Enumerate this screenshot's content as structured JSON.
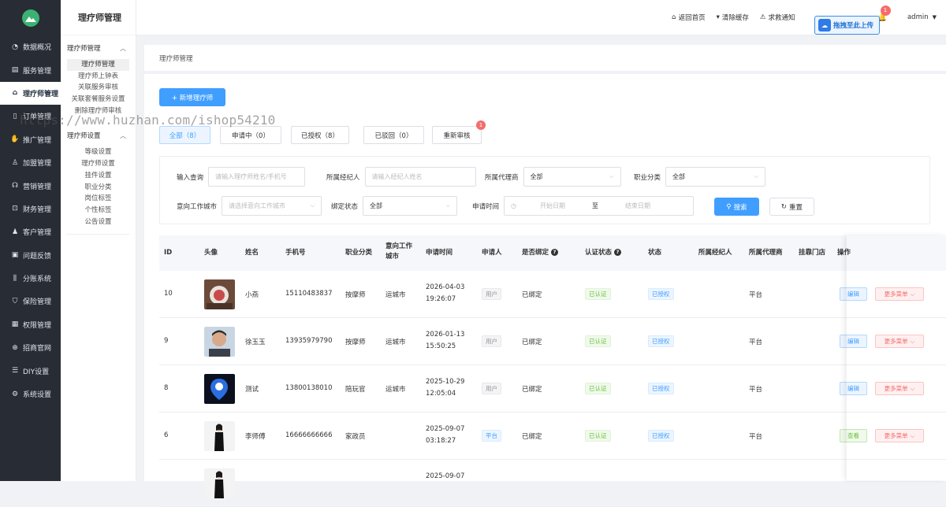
{
  "sidebar": {
    "logo_icon": "mountain-logo",
    "items": [
      {
        "label": "数据概况",
        "icon": "dashboard-icon"
      },
      {
        "label": "服务管理",
        "icon": "service-icon"
      },
      {
        "label": "理疗师管理",
        "icon": "therapist-icon"
      },
      {
        "label": "订单管理",
        "icon": "order-icon"
      },
      {
        "label": "推广管理",
        "icon": "promotion-icon"
      },
      {
        "label": "加盟管理",
        "icon": "franchise-icon"
      },
      {
        "label": "营销管理",
        "icon": "marketing-icon"
      },
      {
        "label": "财务管理",
        "icon": "finance-icon"
      },
      {
        "label": "客户管理",
        "icon": "customer-icon"
      },
      {
        "label": "问题反馈",
        "icon": "feedback-icon"
      },
      {
        "label": "分账系统",
        "icon": "split-icon"
      },
      {
        "label": "保险管理",
        "icon": "insurance-icon"
      },
      {
        "label": "权限管理",
        "icon": "permission-icon"
      },
      {
        "label": "招商官网",
        "icon": "website-icon"
      },
      {
        "label": "DIY设置",
        "icon": "diy-icon"
      },
      {
        "label": "系统设置",
        "icon": "settings-icon"
      }
    ]
  },
  "subnav": {
    "title": "理疗师管理",
    "group1": {
      "label": "理疗师管理",
      "items": [
        "理疗师管理",
        "理疗师上钟表",
        "关联服务审核",
        "关联套餐服务设置",
        "删除理疗师审核"
      ]
    },
    "group2": {
      "label": "理疗师设置",
      "items": [
        "等级设置",
        "理疗师设置",
        "挂件设置",
        "职业分类",
        "岗位标签",
        "个性标签",
        "公告设置"
      ]
    }
  },
  "topbar": {
    "home": "返回首页",
    "clear_cache": "清除缓存",
    "sos": "求救通知",
    "bell_count": "1",
    "user": "admin",
    "upload": "拖拽至此上传"
  },
  "watermark": "https://www.huzhan.com/ishop54210",
  "breadcrumb": "理疗师管理",
  "add_button": "+ 新增理疗师",
  "tabs": [
    {
      "label": "全部（8）"
    },
    {
      "label": "申请中（0）"
    },
    {
      "label": "已授权（8）"
    },
    {
      "label": "已驳回（0）"
    },
    {
      "label": "重新审核",
      "badge": "1"
    }
  ],
  "filters": {
    "query_label": "输入查询",
    "query_placeholder": "请输入理疗师姓名/手机号",
    "agent_label": "所属经纪人",
    "agent_placeholder": "请输入经纪人姓名",
    "proxy_label": "所属代理商",
    "proxy_value": "全部",
    "category_label": "职业分类",
    "category_value": "全部",
    "city_label": "意向工作城市",
    "city_placeholder": "请选择意向工作城市",
    "bind_label": "绑定状态",
    "bind_value": "全部",
    "time_label": "申请时间",
    "start_placeholder": "开始日期",
    "to": "至",
    "end_placeholder": "结束日期",
    "search": "搜索",
    "reset": "重置"
  },
  "table": {
    "headers": {
      "id": "ID",
      "avatar": "头像",
      "name": "姓名",
      "phone": "手机号",
      "category": "职业分类",
      "city": "意向工作城市",
      "apply_time": "申请时间",
      "applicant": "申请人",
      "bound": "是否绑定",
      "cert": "认证状态",
      "status": "状态",
      "agent": "所属经纪人",
      "proxy": "所属代理商",
      "store": "挂靠门店",
      "ops": "操作"
    },
    "rows": [
      {
        "id": "10",
        "name": "小燕",
        "phone": "15110483837",
        "category": "按摩师",
        "city": "运城市",
        "date": "2026-04-03",
        "time": "19:26:07",
        "applicant": "用户",
        "bound": "已绑定",
        "cert": "已认证",
        "status": "已授权",
        "proxy": "平台",
        "op1": "编辑",
        "op2": "更多菜单"
      },
      {
        "id": "9",
        "name": "徐玉玉",
        "phone": "13935979790",
        "category": "按摩师",
        "city": "运城市",
        "date": "2026-01-13",
        "time": "15:50:25",
        "applicant": "用户",
        "bound": "已绑定",
        "cert": "已认证",
        "status": "已授权",
        "proxy": "平台",
        "op1": "编辑",
        "op2": "更多菜单"
      },
      {
        "id": "8",
        "name": "测试",
        "phone": "13800138010",
        "category": "陪玩官",
        "city": "运城市",
        "date": "2025-10-29",
        "time": "12:05:04",
        "applicant": "用户",
        "bound": "已绑定",
        "cert": "已认证",
        "status": "已授权",
        "proxy": "平台",
        "op1": "编辑",
        "op2": "更多菜单"
      },
      {
        "id": "6",
        "name": "李师傅",
        "phone": "16666666666",
        "category": "家政员",
        "city": "",
        "date": "2025-09-07",
        "time": "03:18:27",
        "applicant": "平台",
        "bound": "已绑定",
        "cert": "已认证",
        "status": "已授权",
        "proxy": "平台",
        "op1": "查看",
        "op2": "更多菜单"
      },
      {
        "id": "",
        "name": "",
        "phone": "",
        "category": "",
        "city": "",
        "date": "2025-09-07",
        "time": "",
        "applicant": "",
        "bound": "",
        "cert": "",
        "status": "",
        "proxy": "",
        "op1": "",
        "op2": ""
      }
    ]
  }
}
